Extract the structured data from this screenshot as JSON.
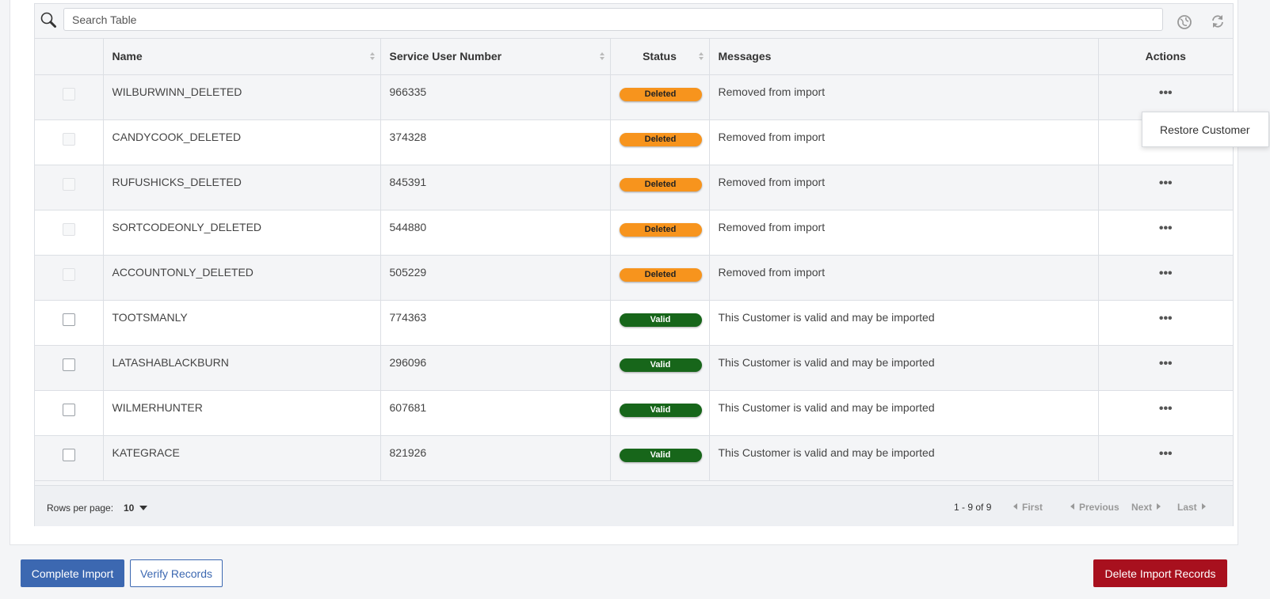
{
  "search": {
    "placeholder": "Search Table"
  },
  "columns": {
    "name": "Name",
    "sun": "Service User Number",
    "status": "Status",
    "messages": "Messages",
    "actions": "Actions"
  },
  "rows": [
    {
      "name": "WILBURWINN_DELETED",
      "sun": "966335",
      "status": "Deleted",
      "message": "Removed from import",
      "selectable": false
    },
    {
      "name": "CANDYCOOK_DELETED",
      "sun": "374328",
      "status": "Deleted",
      "message": "Removed from import",
      "selectable": false
    },
    {
      "name": "RUFUSHICKS_DELETED",
      "sun": "845391",
      "status": "Deleted",
      "message": "Removed from import",
      "selectable": false
    },
    {
      "name": "SORTCODEONLY_DELETED",
      "sun": "544880",
      "status": "Deleted",
      "message": "Removed from import",
      "selectable": false
    },
    {
      "name": "ACCOUNTONLY_DELETED",
      "sun": "505229",
      "status": "Deleted",
      "message": "Removed from import",
      "selectable": false
    },
    {
      "name": "TOOTSMANLY",
      "sun": "774363",
      "status": "Valid",
      "message": "This Customer is valid and may be imported",
      "selectable": true
    },
    {
      "name": "LATASHABLACKBURN",
      "sun": "296096",
      "status": "Valid",
      "message": "This Customer is valid and may be imported",
      "selectable": true
    },
    {
      "name": "WILMERHUNTER",
      "sun": "607681",
      "status": "Valid",
      "message": "This Customer is valid and may be imported",
      "selectable": true
    },
    {
      "name": "KATEGRACE",
      "sun": "821926",
      "status": "Valid",
      "message": "This Customer is valid and may be imported",
      "selectable": true
    }
  ],
  "row_actions_icon": "ellipsis-icon",
  "row_actions_glyph": "•••",
  "popup": {
    "label": "Restore Customer"
  },
  "pagination": {
    "rows_per_page_label": "Rows per page:",
    "rows_per_page_value": "10",
    "page_info": "1 - 9 of 9",
    "first": "First",
    "previous": "Previous",
    "next": "Next",
    "last": "Last"
  },
  "buttons": {
    "complete_import": "Complete Import",
    "verify_records": "Verify Records",
    "delete_import_records": "Delete Import Records"
  },
  "colors": {
    "deleted_badge": "#f7941d",
    "valid_badge": "#17661a",
    "primary": "#3c68b1",
    "danger": "#a8101e"
  }
}
